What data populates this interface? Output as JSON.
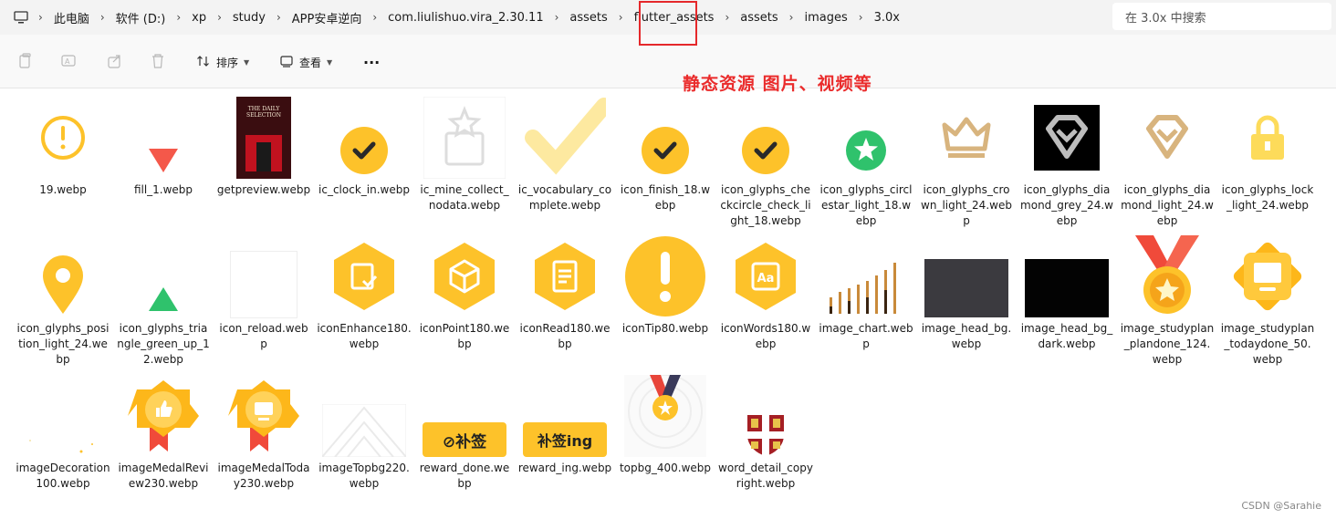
{
  "address_bar": {
    "icon": "computer-icon",
    "crumbs": [
      "此电脑",
      "软件 (D:)",
      "xp",
      "study",
      "APP安卓逆向",
      "com.liulishuo.vira_2.30.11",
      "assets",
      "flutter_assets",
      "assets",
      "images",
      "3.0x"
    ],
    "search_placeholder": "在 3.0x 中搜索"
  },
  "toolbar": {
    "sort_label": "排序",
    "view_label": "查看",
    "more_label": "···"
  },
  "annotation": "静态资源 图片、视频等",
  "watermark": "CSDN @Sarahie",
  "colors": {
    "highlight": "#e5282b",
    "annotation": "#ea2c2c",
    "yellow": "#fdc22a"
  },
  "files": [
    {
      "name": "19.webp",
      "thumb": "exclaim-outline"
    },
    {
      "name": "fill_1.webp",
      "thumb": "red-triangle-down"
    },
    {
      "name": "getpreview.webp",
      "thumb": "book-cover",
      "cover_title": "THE DAILY SELECTION"
    },
    {
      "name": "ic_clock_in.webp",
      "thumb": "check-circle"
    },
    {
      "name": "ic_mine_collect_nodata.webp",
      "thumb": "empty-box"
    },
    {
      "name": "ic_vocabulary_complete.webp",
      "thumb": "big-check"
    },
    {
      "name": "icon_finish_18.webp",
      "thumb": "check-circle"
    },
    {
      "name": "icon_glyphs_checkcircle_check_light_18.webp",
      "thumb": "check-circle"
    },
    {
      "name": "icon_glyphs_circlestar_light_18.webp",
      "thumb": "green-star-circle"
    },
    {
      "name": "icon_glyphs_crown_light_24.webp",
      "thumb": "crown"
    },
    {
      "name": "icon_glyphs_diamond_grey_24.webp",
      "thumb": "diamond-black"
    },
    {
      "name": "icon_glyphs_diamond_light_24.webp",
      "thumb": "diamond-light"
    },
    {
      "name": "icon_glyphs_lock_light_24.webp",
      "thumb": "lock"
    },
    {
      "name": "icon_glyphs_position_light_24.webp",
      "thumb": "pin"
    },
    {
      "name": "icon_glyphs_triangle_green_up_12.webp",
      "thumb": "green-triangle-up"
    },
    {
      "name": "icon_reload.webp",
      "thumb": "blank"
    },
    {
      "name": "iconEnhance180.webp",
      "thumb": "hex-enhance"
    },
    {
      "name": "iconPoint180.webp",
      "thumb": "hex-point"
    },
    {
      "name": "iconRead180.webp",
      "thumb": "hex-read"
    },
    {
      "name": "iconTip80.webp",
      "thumb": "tip-circle"
    },
    {
      "name": "iconWords180.webp",
      "thumb": "hex-words",
      "badge_text": "Aa"
    },
    {
      "name": "image_chart.webp",
      "thumb": "bar-chart"
    },
    {
      "name": "image_head_bg.webp",
      "thumb": "dark-grey-rect"
    },
    {
      "name": "image_head_bg_dark.webp",
      "thumb": "black-rect"
    },
    {
      "name": "image_studyplan_plandone_124.webp",
      "thumb": "medal-red"
    },
    {
      "name": "image_studyplan_todaydone_50.webp",
      "thumb": "badge-orange"
    },
    {
      "name": "imageDecoration100.webp",
      "thumb": "decoration"
    },
    {
      "name": "imageMedalReview230.webp",
      "thumb": "medal-thumb"
    },
    {
      "name": "imageMedalToday230.webp",
      "thumb": "medal-today"
    },
    {
      "name": "imageTopbg220.webp",
      "thumb": "topbg-lines"
    },
    {
      "name": "reward_done.webp",
      "thumb": "reward-done",
      "label": "⊘补签"
    },
    {
      "name": "reward_ing.webp",
      "thumb": "reward-ing",
      "label": "补签ing"
    },
    {
      "name": "topbg_400.webp",
      "thumb": "topbg-medal"
    },
    {
      "name": "word_detail_copyright.webp",
      "thumb": "shield"
    }
  ]
}
